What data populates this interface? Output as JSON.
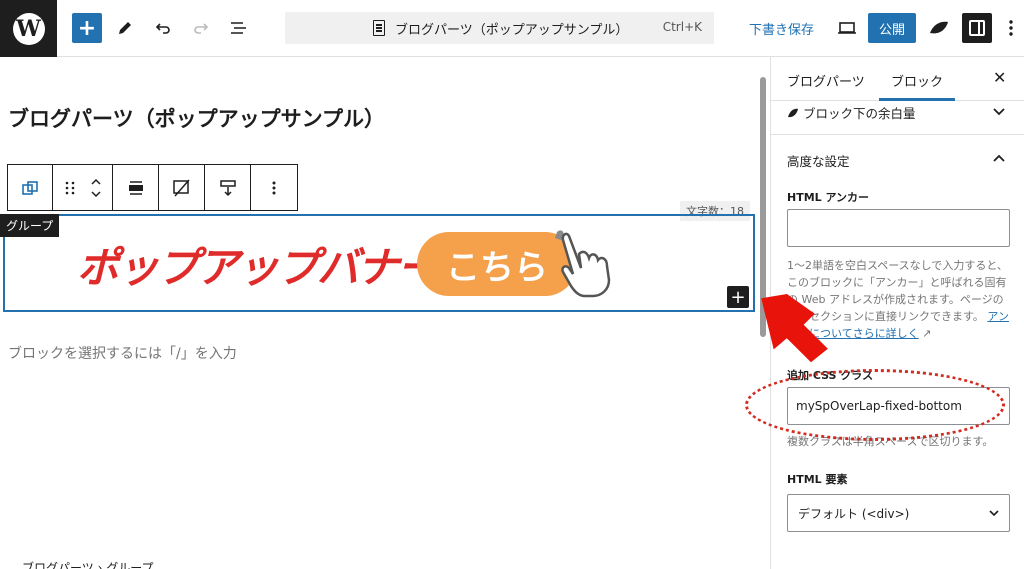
{
  "topbar": {
    "logo_letter": "W",
    "add_label": "+",
    "doc_title": "ブログパーツ（ポップアップサンプル）",
    "shortcut": "Ctrl+K",
    "save_draft": "下書き保存",
    "publish": "公開"
  },
  "editor": {
    "post_title": "ブログパーツ（ポップアップサンプル）",
    "char_count": "文字数：18",
    "group_label": "グループ",
    "banner_text": "ポップアップバナー",
    "banner_button": "こちら",
    "placeholder": "ブロックを選択するには「/」を入力",
    "breadcrumb": "ブログパーツ › グループ"
  },
  "sidebar": {
    "tabs": [
      "ブログパーツ",
      "ブロック"
    ],
    "active_tab": "ブロック",
    "spacing_panel": "ブロック下の余白量",
    "advanced_panel": "高度な設定",
    "html_anchor_label": "HTML アンカー",
    "html_anchor_value": "",
    "anchor_help_1": "1〜2単語を空白スペースなしで入力すると、このブロックに「アンカー」と呼ばれる固有の Web アドレスが作成されます。ページのこのセクションに直接リンクできます。",
    "anchor_help_link": "アンカーについてさらに詳しく",
    "css_class_label": "追加 CSS クラス",
    "css_class_value": "mySpOverLap-fixed-bottom",
    "css_help": "複数クラスは半角スペースで区切ります。",
    "html_element_label": "HTML 要素",
    "html_element_value": "デフォルト (<div>)"
  },
  "colors": {
    "accent": "#2271b1",
    "annotation_red": "#d42a1f",
    "banner_red": "#e02b2b",
    "banner_orange": "#f5a04a"
  }
}
